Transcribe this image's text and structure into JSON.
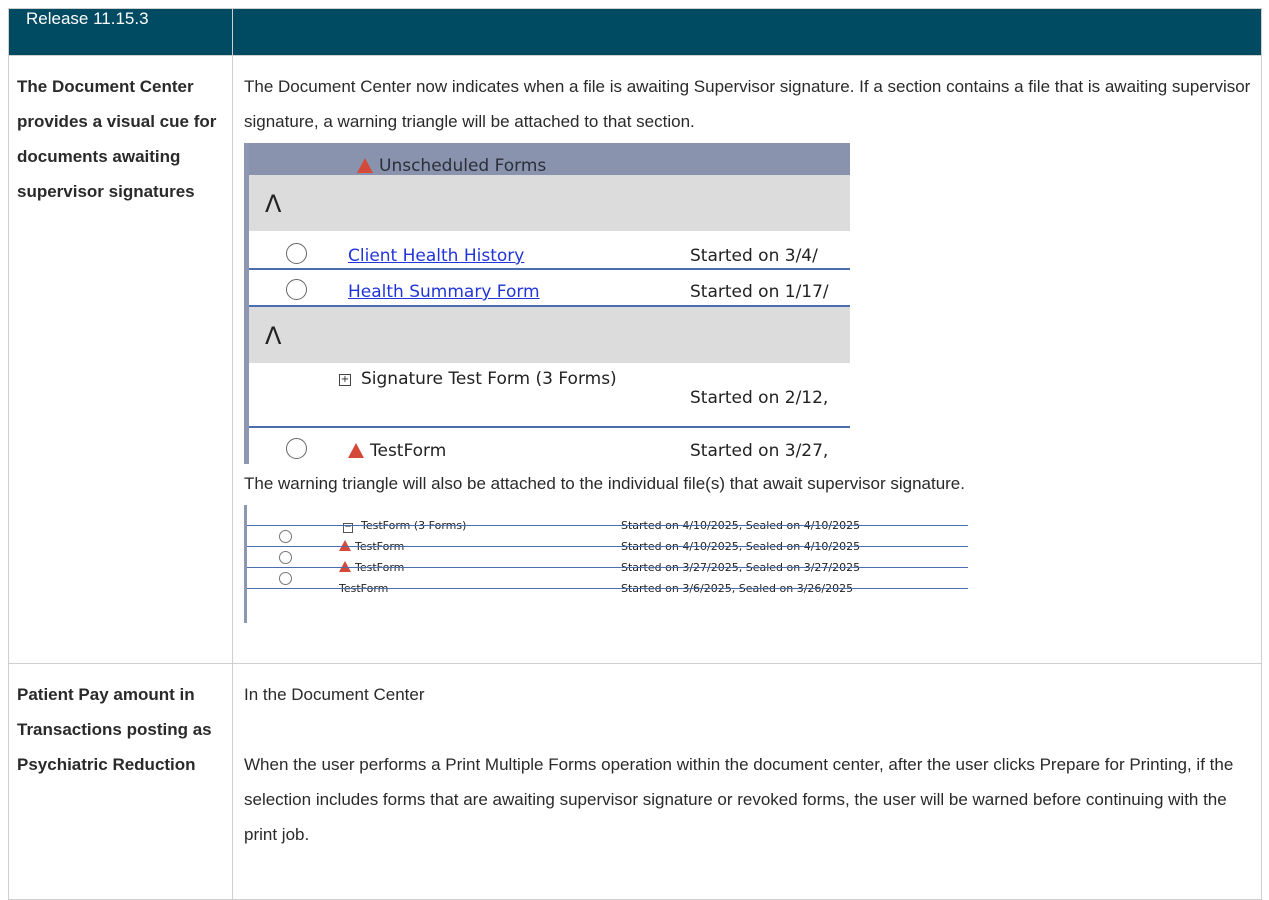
{
  "header": {
    "release": "Release 11.15.3"
  },
  "rows": [
    {
      "feature": "The Document Center provides a visual cue for documents awaiting supervisor signatures",
      "intro": "The Document Center now indicates when a file is awaiting Supervisor signature.  If a section contains a file that is awaiting supervisor signature, a warning triangle will be attached to that section.",
      "screenshot1": {
        "section_title": "Unscheduled Forms",
        "caret": "Λ",
        "items": [
          {
            "name": "Client Health History",
            "status": "Started on 3/4/"
          },
          {
            "name": "Health Summary Form",
            "status": "Started on 1/17/"
          },
          {
            "name": "Signature Test Form (3 Forms)",
            "status": "Started on 2/12,"
          },
          {
            "name": "TestForm",
            "status": "Started on 3/27,"
          }
        ]
      },
      "middle_text": "The warning triangle will also be attached to the individual file(s) that await supervisor signature.",
      "screenshot2": {
        "group": {
          "name": "TestForm (3 Forms)",
          "status": "Started on 4/10/2025, Sealed on 4/10/2025"
        },
        "items": [
          {
            "name": "TestForm",
            "status": "Started on 4/10/2025, Sealed on 4/10/2025",
            "warning": true
          },
          {
            "name": "TestForm",
            "status": "Started on 3/27/2025, Sealed on 3/27/2025",
            "warning": true
          },
          {
            "name": "TestForm",
            "status": "Started on 3/6/2025, Sealed on 3/26/2025",
            "warning": false
          }
        ]
      }
    },
    {
      "feature": "Patient Pay amount in Transactions posting as Psychiatric Reduction",
      "para1": "In the Document Center",
      "para2": "When the user performs a Print Multiple Forms operation within the document center, after the user clicks Prepare for Printing, if the selection  includes forms that are awaiting supervisor signature or revoked forms, the user will be warned before continuing with the print job."
    }
  ],
  "colors": {
    "header_bg": "#004a62",
    "warning": "#d44a3a",
    "link": "#2235d8",
    "row_line": "#4a6eae"
  }
}
